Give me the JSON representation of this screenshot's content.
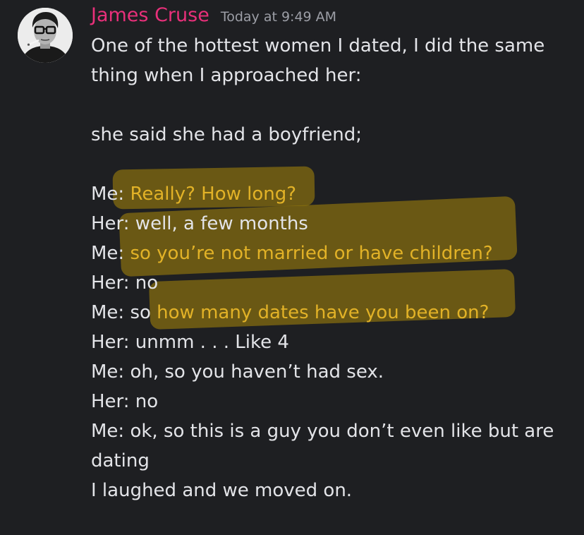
{
  "message": {
    "author": "James Cruse",
    "timestamp": "Today at 9:49 AM",
    "lines": {
      "l0": "One of the hottest women I dated, I did the same",
      "l1": "thing when I approached her:",
      "l2": "",
      "l3": "she said she had a boyfriend;",
      "l4": "",
      "l5a": "Me: ",
      "l5b": "Really? How long?",
      "l6": "Her: well, a few months",
      "l7a": "Me: ",
      "l7b": "so you’re not married or have children?",
      "l8": "Her: no",
      "l9a": "Me: so ",
      "l9b": "how many dates have you been on?",
      "l10": "Her: unmm . . . Like 4",
      "l11": "Me: oh, so you haven’t had sex.",
      "l12": "Her: no",
      "l13": "Me: ok, so this is a guy you don’t even like but are",
      "l14": "dating",
      "l15": "I laughed and we moved on."
    }
  },
  "colors": {
    "background": "#1e1f22",
    "author": "#e8307a",
    "text": "#e3e4e8",
    "timestamp": "#9c9ea6",
    "highlighted_text": "#e2b227",
    "highlighter_mark": "#9a7c0c"
  },
  "icons": {
    "avatar": "user-avatar-photo"
  }
}
